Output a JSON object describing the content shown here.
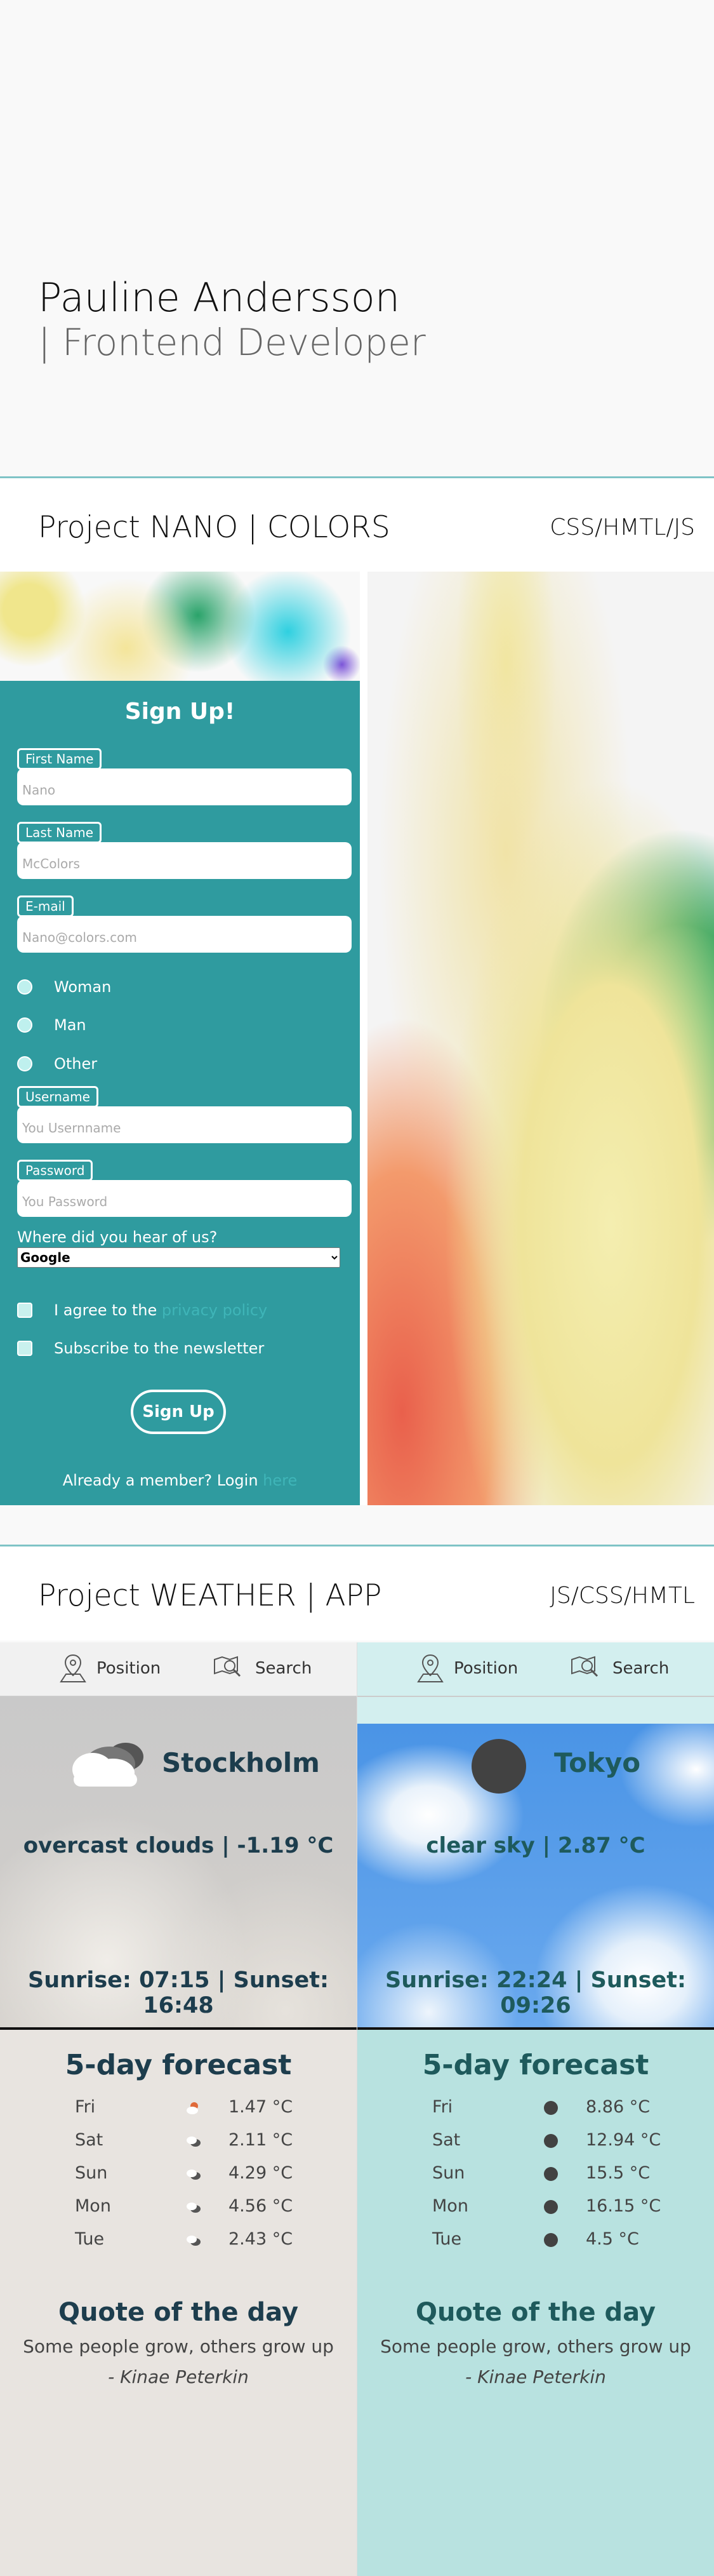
{
  "hero": {
    "name": "Pauline Andersson",
    "role": "| Frontend Developer"
  },
  "nano": {
    "title": "Project NANO | COLORS",
    "tech": "CSS/HMTL/JS",
    "form": {
      "heading": "Sign Up!",
      "fields": [
        {
          "label": "First Name",
          "placeholder": "Nano"
        },
        {
          "label": "Last Name",
          "placeholder": "McColors"
        },
        {
          "label": "E-mail",
          "placeholder": "Nano@colors.com"
        },
        {
          "label": "Username",
          "placeholder": "You Usernname"
        },
        {
          "label": "Password",
          "placeholder": "You Password"
        }
      ],
      "genders": [
        "Woman",
        "Man",
        "Other"
      ],
      "hear_label": "Where did you hear of us?",
      "hear_selected": "Google",
      "agree_prefix": "I agree to the ",
      "agree_link": "privacy policy",
      "newsletter": "Subscribe to the newsletter",
      "submit": "Sign Up",
      "member_prefix": "Already a member? Login ",
      "member_link": "here"
    }
  },
  "weather": {
    "title": "Project WEATHER | APP",
    "tech": "JS/CSS/HMTL",
    "nav": {
      "position": "Position",
      "search": "Search"
    },
    "cities": [
      {
        "name": "Stockholm",
        "condition": "overcast clouds | -1.19 °C",
        "sun": "Sunrise: 07:15 |  Sunset: 16:48",
        "forecast_title": "5-day forecast",
        "forecast": [
          {
            "day": "Fri",
            "temp": "1.47 °C"
          },
          {
            "day": "Sat",
            "temp": "2.11 °C"
          },
          {
            "day": "Sun",
            "temp": "4.29 °C"
          },
          {
            "day": "Mon",
            "temp": "4.56 °C"
          },
          {
            "day": "Tue",
            "temp": "2.43 °C"
          }
        ],
        "quote_title": "Quote of the day",
        "quote": "Some people grow, others grow up",
        "author": "- Kinae Peterkin"
      },
      {
        "name": "Tokyo",
        "condition": "clear sky | 2.87 °C",
        "sun": "Sunrise: 22:24 |  Sunset: 09:26",
        "forecast_title": "5-day forecast",
        "forecast": [
          {
            "day": "Fri",
            "temp": "8.86 °C"
          },
          {
            "day": "Sat",
            "temp": "12.94 °C"
          },
          {
            "day": "Sun",
            "temp": "15.5 °C"
          },
          {
            "day": "Mon",
            "temp": "16.15 °C"
          },
          {
            "day": "Tue",
            "temp": "4.5 °C"
          }
        ],
        "quote_title": "Quote of the day",
        "quote": "Some people grow, others grow up",
        "author": "- Kinae Peterkin"
      }
    ]
  }
}
